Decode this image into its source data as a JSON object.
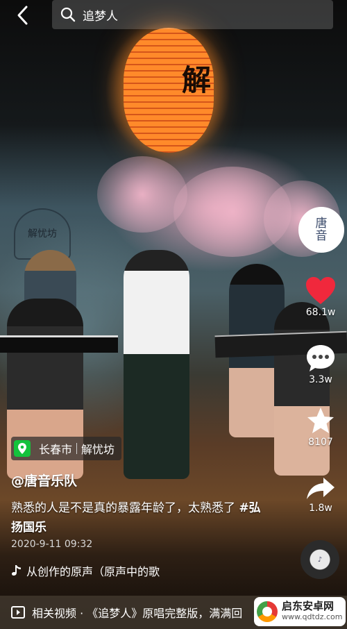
{
  "search": {
    "query": "追梦人"
  },
  "scene": {
    "lantern_char": "解",
    "sign_text": "解忧坊"
  },
  "author_avatar": {
    "text": "唐\n音"
  },
  "actions": {
    "likes": "68.1w",
    "comments": "3.3w",
    "favorites": "8107",
    "shares": "1.8w"
  },
  "location": {
    "city": "长春市",
    "place": "解忧坊"
  },
  "post": {
    "author": "@唐音乐队",
    "caption_text": "熟悉的人是不是真的暴露年龄了，太熟悉了 ",
    "hashtag": "#弘扬国乐",
    "date": "2020-9-11 09:32",
    "music": "从创作的原声（原声中的歌"
  },
  "related": {
    "text": "相关视频 · 《追梦人》原唱完整版，满满回"
  },
  "watermark": {
    "title": "启东安卓网",
    "url": "www.qdtdz.com"
  },
  "colors": {
    "like": "#f0283c",
    "location_icon": "#14c23c"
  }
}
